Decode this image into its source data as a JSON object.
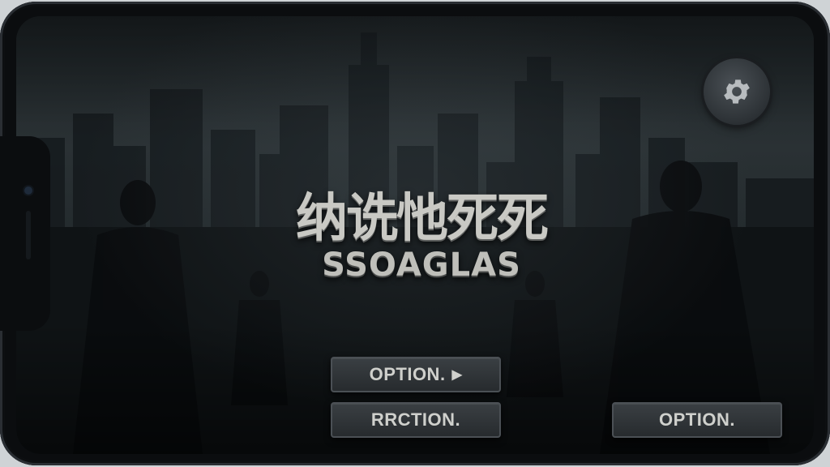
{
  "title": {
    "main": "纳诜忚死死",
    "sub": "SSOAGLAS"
  },
  "menu": {
    "option_top": "OPTION.",
    "option_top_arrow": "▶",
    "option_left": "RRCTION.",
    "option_right": "OPTION."
  },
  "icons": {
    "settings": "gear-icon",
    "arrow": "play-arrow-icon"
  },
  "colors": {
    "background": "#1d2326",
    "button_fill": "#2f3337",
    "text": "#cfd0cc"
  }
}
